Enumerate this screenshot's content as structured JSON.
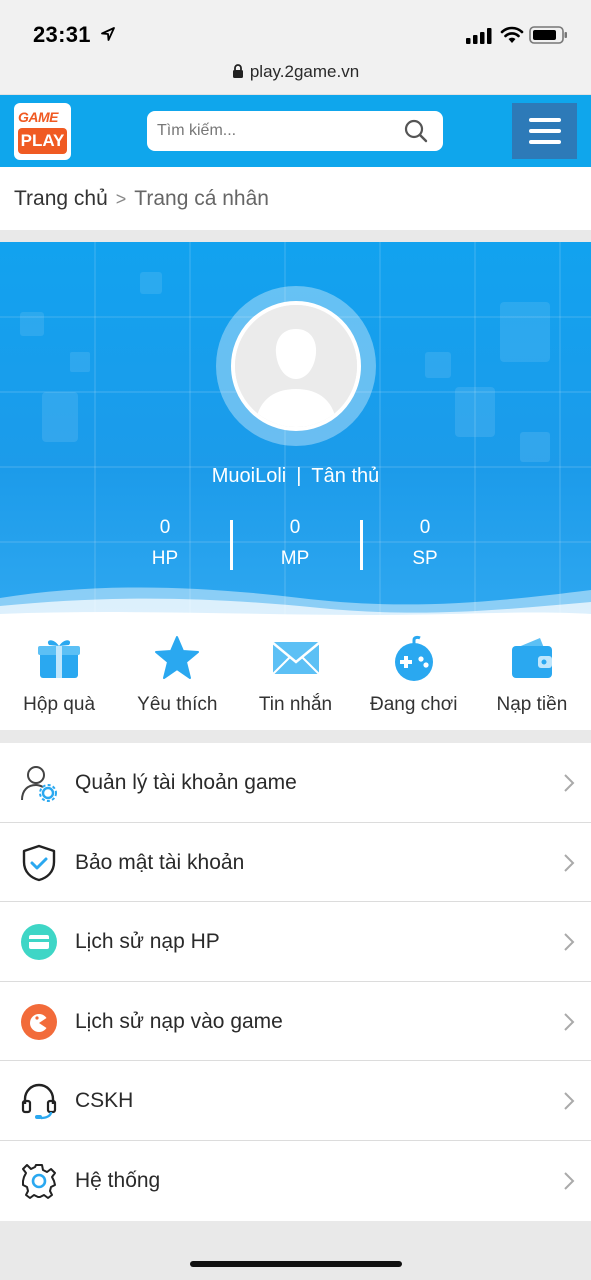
{
  "status_bar": {
    "time": "23:31",
    "url": "play.2game.vn"
  },
  "header": {
    "logo_top": "GAME",
    "logo_bottom": "PLAY",
    "search_placeholder": "Tìm kiếm...",
    "accent_color": "#0fa6ec",
    "menu_button_color": "#2d7ab8"
  },
  "breadcrumb": {
    "home": "Trang chủ",
    "separator": ">",
    "current": "Trang cá nhân"
  },
  "profile": {
    "username": "MuoiLoli",
    "separator": "|",
    "rank": "Tân thủ",
    "stats": [
      {
        "value": "0",
        "label": "HP"
      },
      {
        "value": "0",
        "label": "MP"
      },
      {
        "value": "0",
        "label": "SP"
      }
    ]
  },
  "quick_actions": [
    {
      "label": "Hộp quà",
      "icon": "gift-icon"
    },
    {
      "label": "Yêu thích",
      "icon": "star-icon"
    },
    {
      "label": "Tin nhắn",
      "icon": "mail-icon"
    },
    {
      "label": "Đang chơi",
      "icon": "gamepad-icon"
    },
    {
      "label": "Nạp tiền",
      "icon": "wallet-icon"
    }
  ],
  "menu": [
    {
      "label": "Quản lý tài khoản game",
      "icon": "user-settings-icon"
    },
    {
      "label": "Bảo mật tài khoản",
      "icon": "shield-check-icon"
    },
    {
      "label": "Lịch sử nạp HP",
      "icon": "card-icon"
    },
    {
      "label": "Lịch sử nạp vào game",
      "icon": "game-history-icon"
    },
    {
      "label": "CSKH",
      "icon": "headset-icon"
    },
    {
      "label": "Hệ thống",
      "icon": "gear-icon"
    }
  ]
}
